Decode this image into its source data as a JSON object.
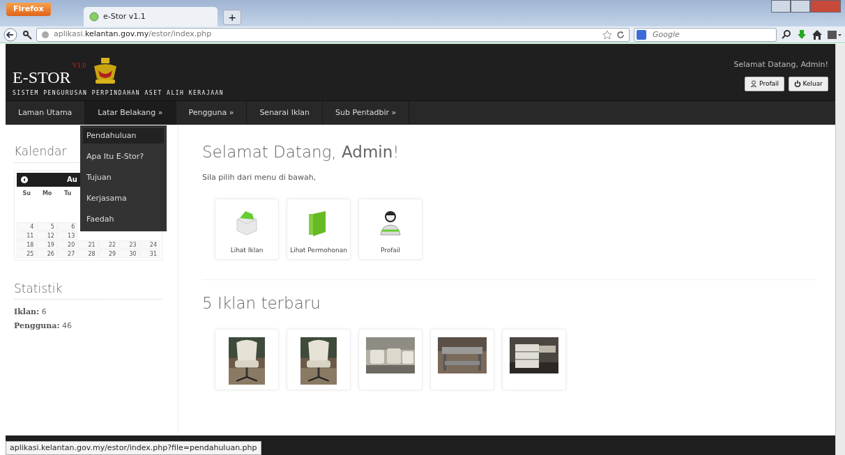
{
  "browser": {
    "menu_button": "Firefox",
    "tab_title": "e-Stor v1.1",
    "new_tab": "+",
    "url": "aplikasi.**kelantan.gov.my**/estor/index.php",
    "search_placeholder": "Google",
    "status_url": "aplikasi.kelantan.gov.my/estor/index.php?file=pendahuluan.php"
  },
  "header": {
    "logo": "E-STOR",
    "version": "V1.0",
    "tagline": "SISTEM PENGURUSAN PERPINDAHAN ASET ALIH KERAJAAN",
    "welcome": "Selamat Datang, Admin!",
    "buttons": [
      {
        "label": "Profail",
        "kind": "user"
      },
      {
        "label": "Keluar",
        "kind": "power"
      }
    ]
  },
  "nav": [
    {
      "label": "Laman Utama",
      "expanded": false
    },
    {
      "label": "Latar Belakang »",
      "expanded": true
    },
    {
      "label": "Pengguna »",
      "expanded": false
    },
    {
      "label": "Senarai Iklan",
      "expanded": false
    },
    {
      "label": "Sub Pentadbir »",
      "expanded": false
    }
  ],
  "dropdown": [
    {
      "label": "Pendahuluan",
      "selected": true
    },
    {
      "label": "Apa Itu E-Stor?",
      "selected": false
    },
    {
      "label": "Tujuan",
      "selected": false
    },
    {
      "label": "Kerjasama",
      "selected": false
    },
    {
      "label": "Faedah",
      "selected": false
    }
  ],
  "sidebar": {
    "calendar_title": "Kalendar",
    "month": "Au",
    "weekdays": [
      "Su",
      "Mo",
      "Tu"
    ],
    "weeks": [
      [
        "4",
        "5",
        "6"
      ],
      [
        "11",
        "12",
        "13"
      ],
      [
        "18",
        "19",
        "20",
        "21",
        "22",
        "23",
        "24"
      ],
      [
        "25",
        "26",
        "27",
        "28",
        "29",
        "30",
        "31"
      ]
    ],
    "stats_title": "Statistik",
    "stats": [
      {
        "label": "Iklan:",
        "value": "6"
      },
      {
        "label": "Pengguna:",
        "value": "46"
      }
    ]
  },
  "main": {
    "title": "Selamat Datang, **Admin**!",
    "subtitle": "Sila pilih dari menu di bawah,",
    "tiles": [
      {
        "label": "Lihat Iklan",
        "kind": "box"
      },
      {
        "label": "Lihat Permohonan",
        "kind": "folder"
      },
      {
        "label": "Profail",
        "kind": "person"
      }
    ],
    "latest_title": "5 Iklan terbaru"
  }
}
